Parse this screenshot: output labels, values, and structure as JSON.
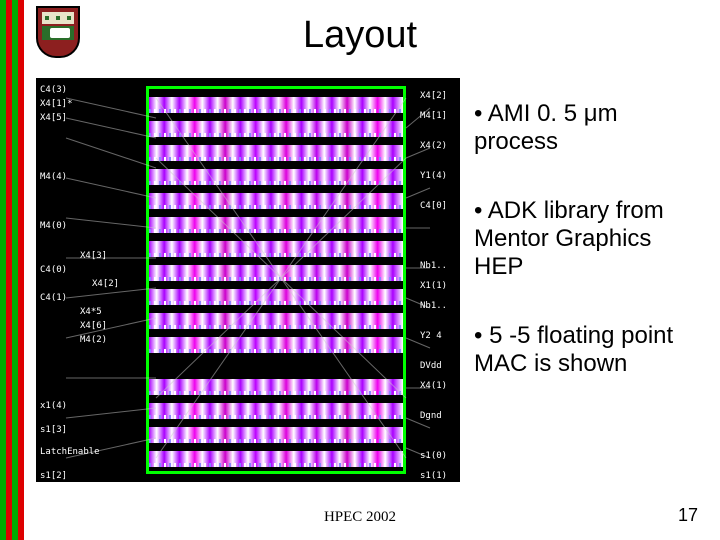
{
  "title": "Layout",
  "bullets": [
    "• AMI 0. 5 μm process",
    "• ADK library from Mentor Graphics HEP",
    "• 5 -5 floating point MAC is shown"
  ],
  "footer": {
    "conference": "HPEC 2002",
    "page": "17"
  },
  "chip": {
    "left_labels": [
      "C4(3)",
      "X4[1]*",
      "X4[5]",
      "M4(4)",
      "M4(0)",
      "X4[3]",
      "C4(0)",
      "X4[2]",
      "C4(1)",
      "X4*5",
      "X4[6]",
      "M4(2)",
      "x1(4)",
      "s1[3]",
      "LatchEnable",
      "s1[2]"
    ],
    "right_labels": [
      "X4[2]",
      "M4[1]",
      "X4(2)",
      "Y1(4)",
      "C4[0]",
      "Nb1..",
      "X1(1)",
      "Nb1..",
      "Y2 4",
      "DVdd",
      "X4(1)",
      "Dgnd",
      "s1(0)",
      "s1(1)"
    ]
  }
}
